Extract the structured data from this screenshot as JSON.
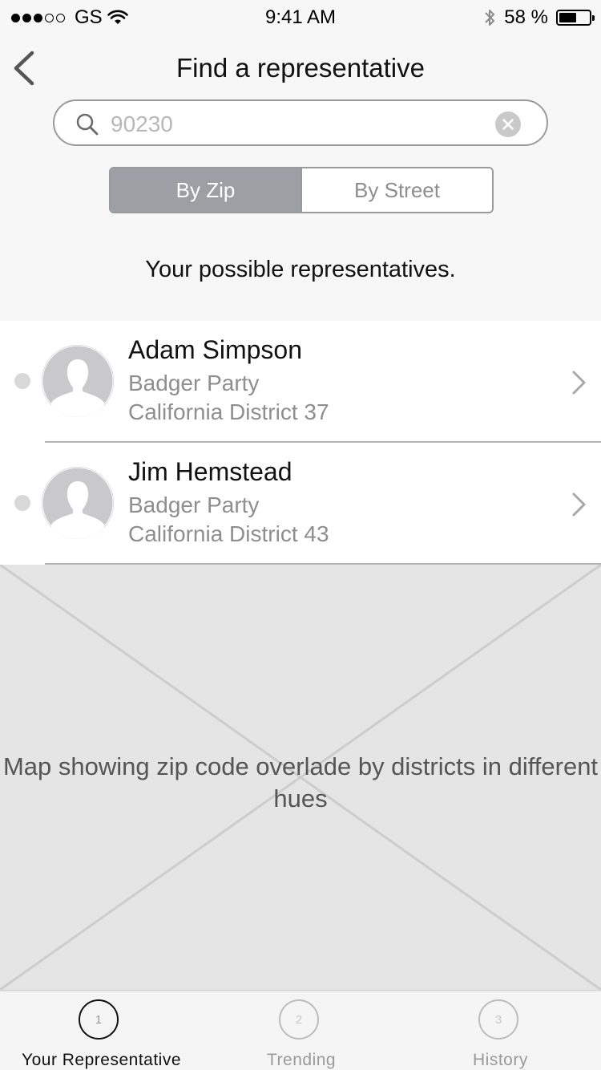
{
  "status_bar": {
    "carrier": "GS",
    "time": "9:41 AM",
    "battery_text": "58 %",
    "battery_level": 0.58,
    "signal_bars_filled": 3,
    "signal_bars_total": 5
  },
  "header": {
    "title": "Find a representative",
    "back_icon": "chevron-left-icon"
  },
  "search": {
    "placeholder": "90230",
    "value": "",
    "search_icon": "search-icon",
    "clear_icon": "clear-icon"
  },
  "segmented": {
    "options": [
      "By Zip",
      "By Street"
    ],
    "selected": "By Zip"
  },
  "subtitle": "Your possible representatives.",
  "representatives": [
    {
      "name": "Adam Simpson",
      "party": "Badger Party",
      "district": "California District 37"
    },
    {
      "name": "Jim Hemstead",
      "party": "Badger Party",
      "district": "California District 43"
    }
  ],
  "map": {
    "label": "Map showing zip code overlade by districts in different hues"
  },
  "tabs": [
    {
      "number": "1",
      "label": "Your Representative",
      "active": true
    },
    {
      "number": "2",
      "label": "Trending",
      "active": false
    },
    {
      "number": "3",
      "label": "History",
      "active": false
    }
  ],
  "colors": {
    "background": "#f7f7f7",
    "segment_active": "#9c9fa3",
    "secondary_text": "#8e8e8e",
    "map_placeholder": "#e5e5e5"
  }
}
